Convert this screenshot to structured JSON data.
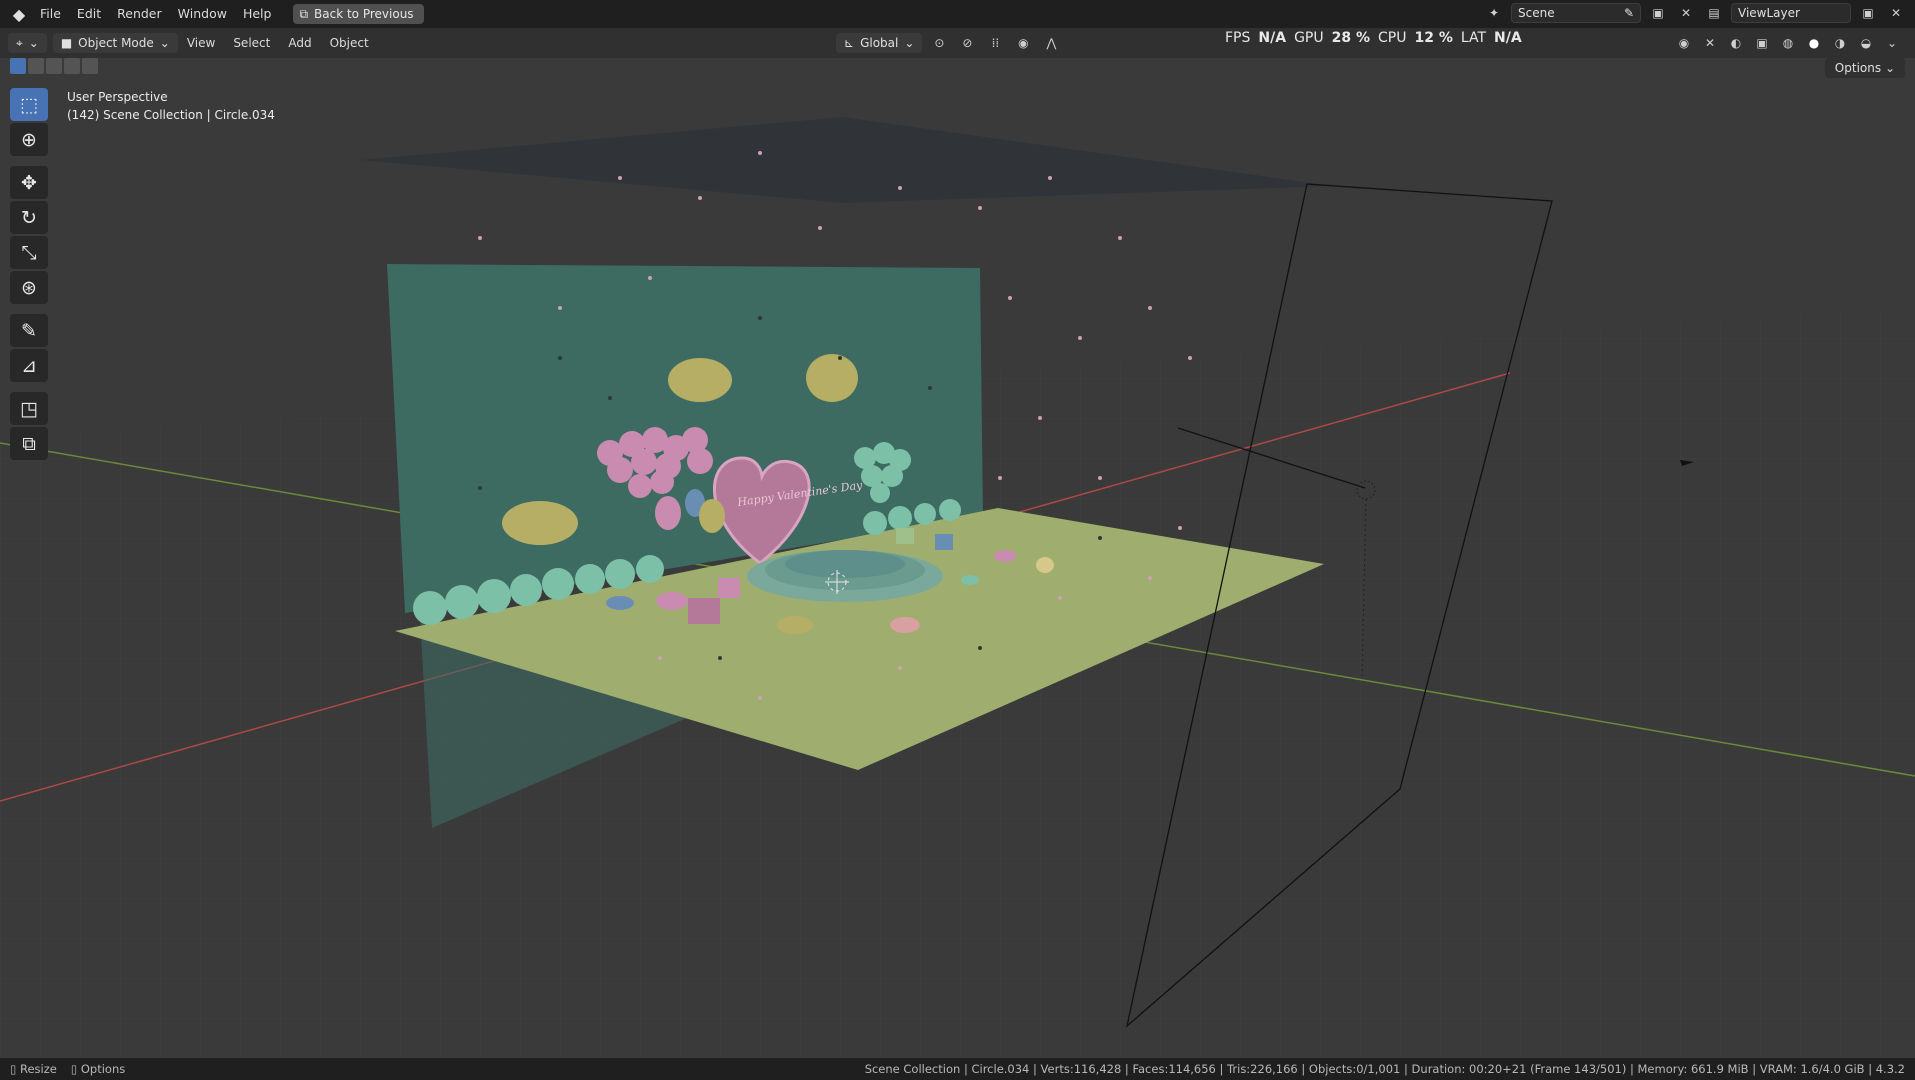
{
  "menu": {
    "file": "File",
    "edit": "Edit",
    "render": "Render",
    "window": "Window",
    "help": "Help",
    "back": "Back to Previous"
  },
  "topright": {
    "scene": "Scene",
    "view_layer": "ViewLayer"
  },
  "header": {
    "mode": "Object Mode",
    "view": "View",
    "select": "Select",
    "add": "Add",
    "object": "Object",
    "orientation": "Global",
    "options": "Options"
  },
  "stats": {
    "fps_label": "FPS",
    "fps_value": "N/A",
    "gpu_label": "GPU",
    "gpu_value": "28 %",
    "cpu_label": "CPU",
    "cpu_value": "12 %",
    "lat_label": "LAT",
    "lat_value": "N/A"
  },
  "viewport": {
    "perspective": "User Perspective",
    "collection": "(142) Scene Collection | Circle.034",
    "card_text": "Happy Valentine's Day"
  },
  "status": {
    "resize": "Resize",
    "options": "Options",
    "summary": "Scene Collection | Circle.034 | Verts:116,428 | Faces:114,656 | Tris:226,166 | Objects:0/1,001 | Duration: 00:20+21 (Frame 143/501) | Memory: 661.9 MiB | VRAM: 1.6/4.0 GiB | 4.3.2"
  },
  "icons": {
    "logo": "blender-logo-icon",
    "editor": "3d-viewport-editor-icon",
    "tools": [
      "select-box-icon",
      "cursor-icon",
      "move-icon",
      "rotate-icon",
      "scale-icon",
      "transform-icon",
      "annotate-icon",
      "measure-icon",
      "add-cube-icon",
      "add-object-icon"
    ]
  },
  "colors": {
    "accent": "#4772b3",
    "background": "#3a3a3a",
    "wall": "#3e6a61",
    "floor": "#9fae6e",
    "pink": "#c98bb0",
    "teal": "#7cc0a8"
  }
}
